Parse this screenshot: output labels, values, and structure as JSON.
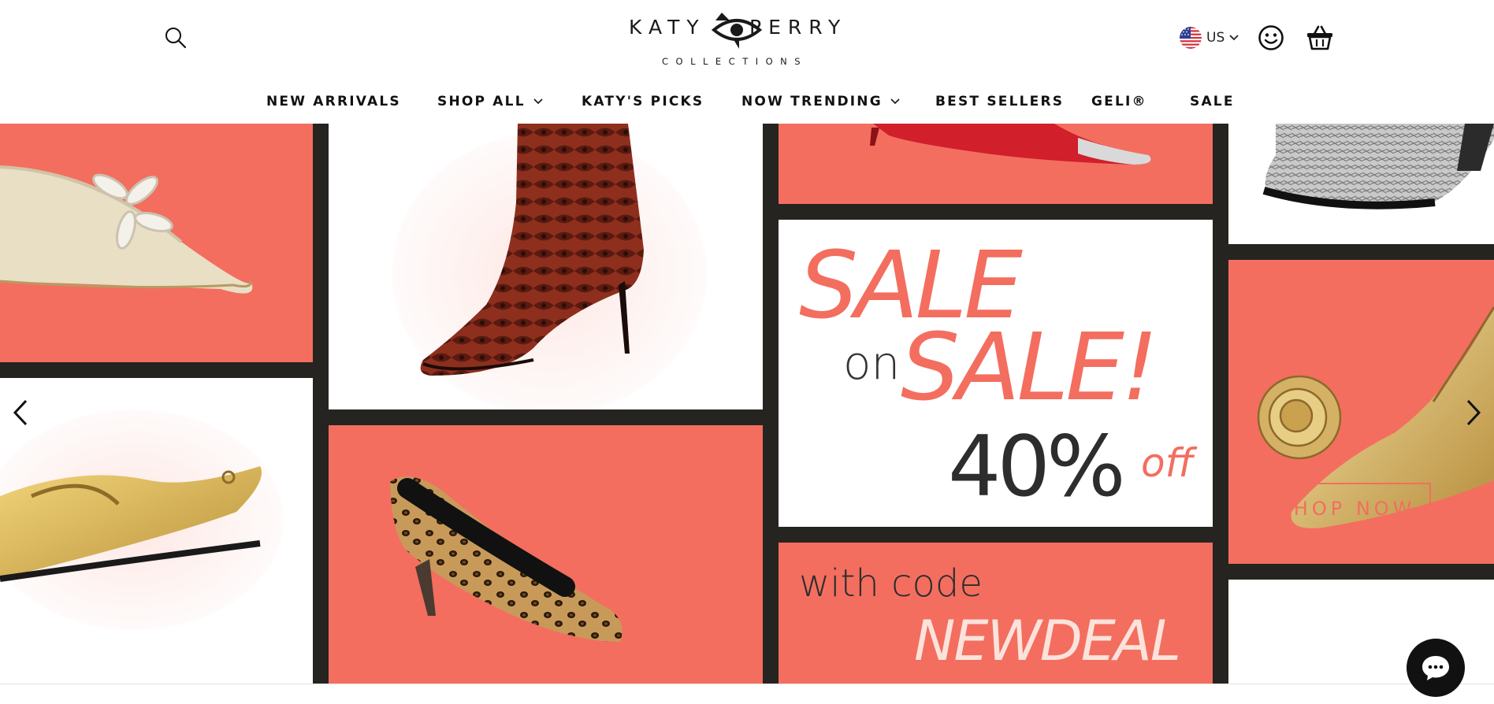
{
  "brand": {
    "name_left": "KATY",
    "name_right": "PERRY",
    "subtitle": "COLLECTIONS"
  },
  "header": {
    "locale": {
      "code": "US",
      "flag": "us-flag-icon"
    },
    "icons": [
      "search-icon",
      "account-smiley-icon",
      "cart-basket-icon"
    ]
  },
  "nav": {
    "items": [
      {
        "label": "NEW ARRIVALS",
        "has_dropdown": false
      },
      {
        "label": "SHOP ALL",
        "has_dropdown": true
      },
      {
        "label": "KATY'S PICKS",
        "has_dropdown": false
      },
      {
        "label": "NOW TRENDING",
        "has_dropdown": true
      },
      {
        "label": "BEST SELLERS",
        "has_dropdown": false
      },
      {
        "label": "GELI®",
        "has_dropdown": false
      },
      {
        "label": "SALE",
        "has_dropdown": false
      }
    ]
  },
  "hero": {
    "promo": {
      "line1": "SALE",
      "line2_small": "on",
      "line2_big": "SALE!",
      "percent": "40%",
      "off": "off",
      "code_prefix": "with code",
      "code": "NEWDEAL"
    },
    "cta_label": "SHOP NOW",
    "products": [
      "cream-flower-flat",
      "snakeskin-boot",
      "red-silver-toe-pump",
      "silver-metallic-shoe",
      "gold-slingback-flat",
      "leopard-kitten-heel",
      "gold-rosette-pump"
    ]
  },
  "colors": {
    "coral": "#f36e5f",
    "dark_frame": "#262420",
    "text_dark": "#111111",
    "sale_text": "#f36e5f"
  },
  "widgets": {
    "chat": "chat-bubble-icon",
    "prev": "chevron-left-icon",
    "next": "chevron-right-icon"
  }
}
